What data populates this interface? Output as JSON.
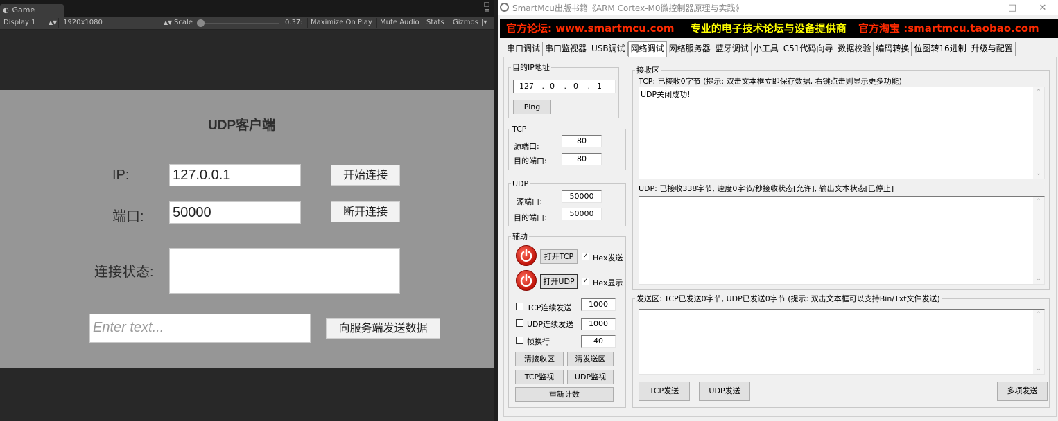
{
  "unity": {
    "tab_label": "Game",
    "toolbar": {
      "display": "Display 1",
      "resolution": "1920x1080",
      "scale_label": "Scale",
      "scale_value": "0.37:",
      "maximize": "Maximize On Play",
      "mute": "Mute Audio",
      "stats": "Stats",
      "gizmos": "Gizmos"
    },
    "scene": {
      "title": "UDP客户端",
      "ip_label": "IP:",
      "ip_value": "127.0.0.1",
      "port_label": "端口:",
      "port_value": "50000",
      "connect_button": "开始连接",
      "disconnect_button": "断开连接",
      "status_label": "连接状态:",
      "status_value": "",
      "message_placeholder": "Enter text...",
      "send_button": "向服务端发送数据"
    }
  },
  "smartmcu": {
    "window_title": "SmartMcu出版书籍《ARM Cortex-M0微控制器原理与实践》",
    "banner": {
      "part1": "官方论坛: www.smartmcu.com",
      "part2": "专业的电子技术论坛与设备提供商",
      "part3": "官方淘宝 :smartmcu.taobao.com"
    },
    "tabs": [
      "串口调试",
      "串口监视器",
      "USB调试",
      "网络调试",
      "网络服务器",
      "蓝牙调试",
      "小工具",
      "C51代码向导",
      "数据校验",
      "编码转换",
      "位图转16进制",
      "升级与配置"
    ],
    "active_tab": "网络调试",
    "target_ip": {
      "legend": "目的IP地址",
      "octets": [
        "127",
        "0",
        "0",
        "1"
      ],
      "ping_button": "Ping"
    },
    "tcp": {
      "legend": "TCP",
      "src_label": "源端口:",
      "src_value": "80",
      "dst_label": "目的端口:",
      "dst_value": "80"
    },
    "udp": {
      "legend": "UDP",
      "src_label": "源端口:",
      "src_value": "50000",
      "dst_label": "目的端口:",
      "dst_value": "50000"
    },
    "aux": {
      "legend": "辅助",
      "open_tcp": "打开TCP",
      "open_udp": "打开UDP",
      "hex_send": "Hex发送",
      "hex_show": "Hex显示",
      "tcp_cont": "TCP连续发送",
      "tcp_cont_val": "1000",
      "udp_cont": "UDP连续发送",
      "udp_cont_val": "1000",
      "frame_newline": "帧换行",
      "frame_val": "40",
      "clear_recv": "清接收区",
      "clear_send": "清发送区",
      "tcp_monitor": "TCP监视",
      "udp_monitor": "UDP监视",
      "recount": "重新计数"
    },
    "recv": {
      "legend": "接收区",
      "tcp_info": "TCP: 已接收0字节 (提示: 双击文本框立即保存数据, 右键点击则显示更多功能)",
      "tcp_text": "UDP关闭成功!",
      "udp_info": "UDP: 已接收338字节, 速度0字节/秒接收状态[允许], 输出文本状态[已停止]",
      "udp_text": ""
    },
    "send": {
      "legend": "发送区: TCP已发送0字节, UDP已发送0字节 (提示: 双击文本框可以支持Bin/Txt文件发送)",
      "text": "",
      "tcp_send": "TCP发送",
      "udp_send": "UDP发送",
      "multi_send": "多项发送"
    },
    "colors": {
      "banner_bg": "#000000",
      "banner_red": "#ff2a00",
      "banner_yellow": "#ffff00"
    }
  }
}
